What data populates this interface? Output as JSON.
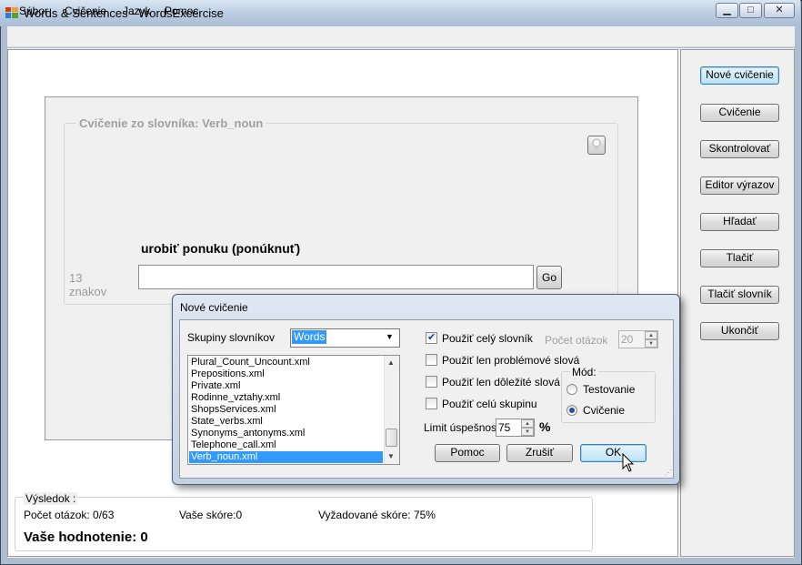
{
  "window": {
    "title": "Words & Sentences - WordsExcercise",
    "caption_buttons": [
      "▁",
      "□",
      "✕"
    ]
  },
  "menu": [
    "Súbor",
    "Cvičenie",
    "Jazyk",
    "Pomoc"
  ],
  "sidebar": {
    "buttons": [
      {
        "label": "Nové cvičenie"
      },
      {
        "label": "Cvičenie"
      },
      {
        "label": "Skontrolovať"
      },
      {
        "label": "Editor výrazov"
      },
      {
        "label": "Hľadať"
      },
      {
        "label": "Tlačiť"
      },
      {
        "label": "Tlačiť slovník"
      },
      {
        "label": "Ukončiť"
      }
    ]
  },
  "exercise": {
    "legend": "Cvičenie zo slovníka: Verb_noun",
    "prompt": "urobiť ponuku (ponúknuť)",
    "char_count_1": "13",
    "char_count_2": "znakov",
    "answer_value": "",
    "go_label": "Go",
    "hint_icon": "lightbulb-icon"
  },
  "result": {
    "legend": "Výsledok :",
    "questions": "Počet otázok: 0/63",
    "score": "Vaše skóre:0",
    "required": "Vyžadované skóre: 75%",
    "rating": "Vaše hodnotenie: 0"
  },
  "dialog": {
    "title": "Nové cvičenie",
    "groups_label": "Skupiny slovníkov",
    "groups_value": "Words",
    "files": [
      "Plural_Count_Uncount.xml",
      "Prepositions.xml",
      "Private.xml",
      "Rodinne_vztahy.xml",
      "ShopsServices.xml",
      "State_verbs.xml",
      "Synonyms_antonyms.xml",
      "Telephone_call.xml",
      "Verb_noun.xml"
    ],
    "selected_file": "Verb_noun.xml",
    "use_whole_dict": {
      "label": "Použiť celý slovník",
      "checked": true
    },
    "use_problem": {
      "label": "Použiť len problémové slová",
      "checked": false
    },
    "use_important": {
      "label": "Použiť len dôležité slová",
      "checked": false
    },
    "use_group": {
      "label": "Použiť celú skupinu",
      "checked": false
    },
    "question_count_label": "Počet otázok",
    "question_count_value": "20",
    "limit_label": "Limit úspešnosti",
    "limit_value": "75",
    "limit_unit": "%",
    "mode_legend": "Mód:",
    "mode_test": "Testovanie",
    "mode_exercise": "Cvičenie",
    "mode_selected": "Cvičenie",
    "help_label": "Pomoc",
    "cancel_label": "Zrušiť",
    "ok_label": "OK"
  }
}
